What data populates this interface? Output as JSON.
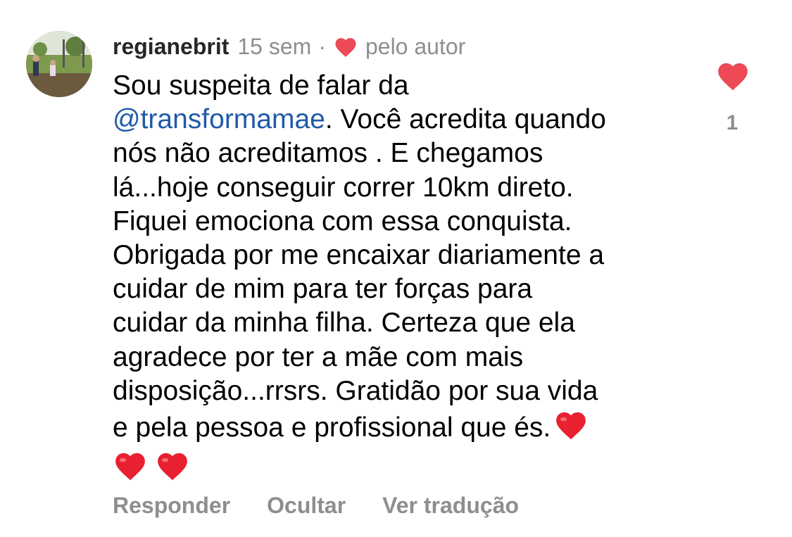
{
  "comment": {
    "username": "regianebrit",
    "time": "15 sem",
    "separator": "·",
    "liked_by_author_label": "pelo autor",
    "mention": "@transformamae",
    "text_lines": [
      "Sou suspeita de falar da",
      ". Você acredita quando",
      "nós não acreditamos . E chegamos",
      "lá...hoje conseguir correr 10km direto.",
      "Fiquei emociona com essa conquista.",
      "Obrigada por me encaixar diariamente a",
      "cuidar de mim para ter forças para",
      "cuidar da minha filha. Certeza que ela",
      "agradece por ter a mãe com mais",
      "disposição...rrsrs.  Gratidão por sua vida",
      "e pela pessoa e profissional que és."
    ],
    "emoji": [
      "red-heart",
      "red-heart",
      "red-heart"
    ],
    "like_count": "1"
  },
  "actions": {
    "reply_label": "Responder",
    "hide_label": "Ocultar",
    "translate_label": "Ver tradução"
  },
  "colors": {
    "heart_red": "#ed4956",
    "mention_blue": "#1f5aa8",
    "secondary_gray": "#8e8e8e"
  }
}
